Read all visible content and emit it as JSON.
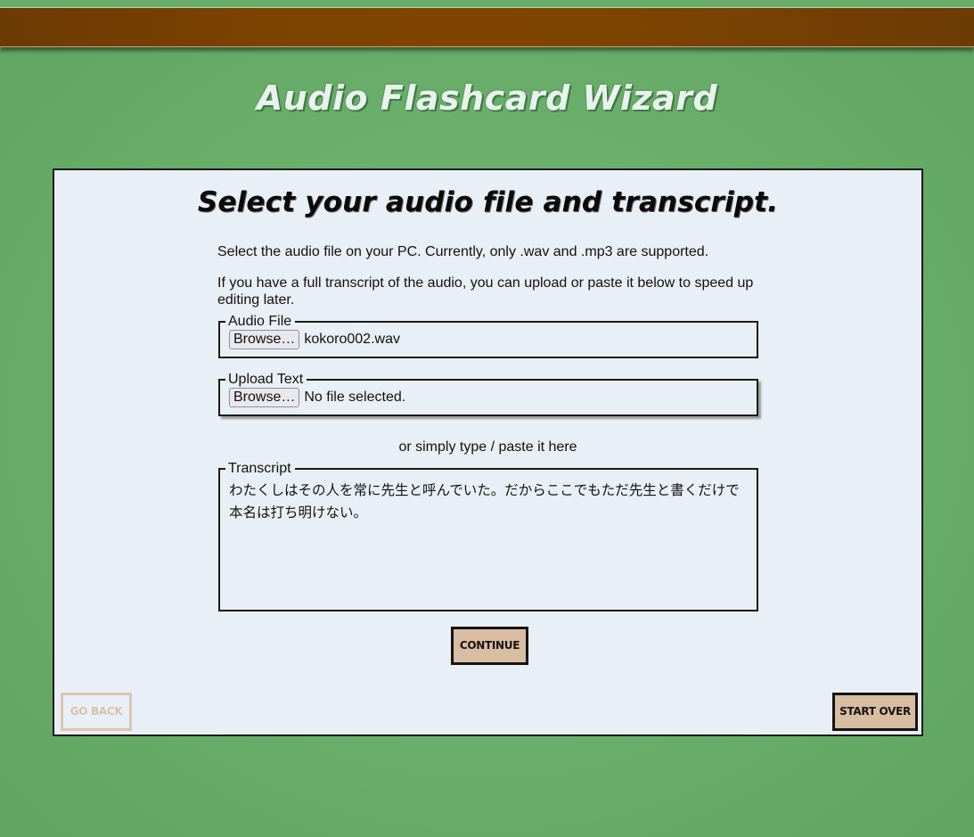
{
  "app": {
    "title": "Audio Flashcard Wizard"
  },
  "step": {
    "heading": "Select your audio file and transcript.",
    "intro_line_1": "Select the audio file on your PC. Currently, only .wav and .mp3 are supported.",
    "intro_line_2": "If you have a full transcript of the audio, you can upload or paste it below to speed up editing later."
  },
  "audio_file": {
    "legend": "Audio File",
    "browse_label": "Browse…",
    "file_name": "kokoro002.wav"
  },
  "upload_text": {
    "legend": "Upload Text",
    "browse_label": "Browse…",
    "file_name": "No file selected."
  },
  "or_text": "or simply type / paste it here",
  "transcript": {
    "legend": "Transcript",
    "value": "わたくしはその人を常に先生と呼んでいた。だからここでもただ先生と書くだけで本名は打ち明けない。"
  },
  "buttons": {
    "continue": "Continue",
    "go_back": "Go Back",
    "start_over": "Start Over"
  },
  "colors": {
    "background_green": "#6bb06c",
    "wood_bar": "#7d4300",
    "panel": "#e9eff6",
    "button_fill": "#d8bda2",
    "disabled_button": "#dcc7ae"
  }
}
